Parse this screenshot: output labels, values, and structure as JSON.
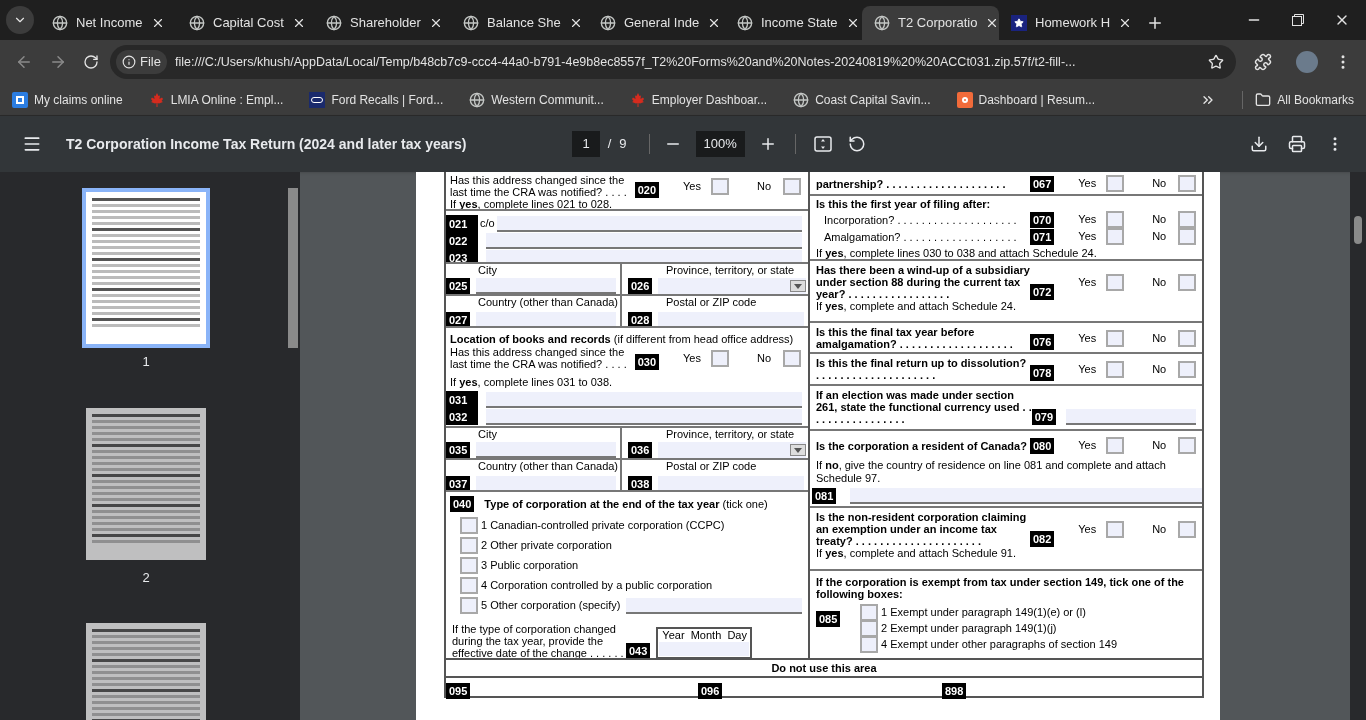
{
  "tabs": [
    {
      "title": "Net Income",
      "selected": false
    },
    {
      "title": "Capital Cost",
      "selected": false
    },
    {
      "title": "Shareholder",
      "selected": false
    },
    {
      "title": "Balance She",
      "selected": false
    },
    {
      "title": "General Inde",
      "selected": false
    },
    {
      "title": "Income State",
      "selected": false
    },
    {
      "title": "T2 Corporatio",
      "selected": true
    },
    {
      "title": "Homework H",
      "selected": false
    }
  ],
  "address": {
    "chip": "File",
    "url": "file:///C:/Users/khush/AppData/Local/Temp/b48cb7c9-ccc4-44a0-b791-4e9b8ec8557f_T2%20Forms%20and%20Notes-20240819%20%20ACCt031.zip.57f/t2-fill-..."
  },
  "bookmarks": [
    {
      "label": "My claims online"
    },
    {
      "label": "LMIA Online : Empl..."
    },
    {
      "label": "Ford Recalls | Ford..."
    },
    {
      "label": "Western Communit..."
    },
    {
      "label": "Employer Dashboar..."
    },
    {
      "label": "Coast Capital Savin..."
    },
    {
      "label": "Dashboard | Resum..."
    }
  ],
  "all_bookmarks": "All Bookmarks",
  "pdf": {
    "title": "T2 Corporation Income Tax Return (2024 and later tax years)",
    "page": "1",
    "separator": "/",
    "total": "9",
    "zoom": "100%"
  },
  "thumbnails": [
    {
      "label": "1",
      "selected": true
    },
    {
      "label": "2",
      "selected": false
    },
    {
      "selected": false
    }
  ],
  "left": [
    {
      "kind": "yesno",
      "question": "Has this address changed since the last time the CRA was notified? . . . .",
      "code": "020",
      "yes": "Yes",
      "no": "No",
      "yes_checked": false,
      "no_checked": false,
      "note": "If **yes**, complete lines 021 to 028."
    },
    {
      "kind": "lines",
      "lines": [
        {
          "code": "021",
          "prefix": "c/o"
        },
        {
          "code": "022"
        },
        {
          "code": "023"
        }
      ]
    },
    {
      "kind": "grid",
      "cells": [
        {
          "label": "City",
          "code": "025",
          "dropdown": false
        },
        {
          "label": "Province, territory, or state",
          "code": "026",
          "dropdown": true
        },
        {
          "label": "Country (other than Canada)",
          "code": "027",
          "dropdown": false
        },
        {
          "label": "Postal or ZIP code",
          "code": "028",
          "dropdown": false
        }
      ]
    },
    {
      "kind": "books",
      "heading": "**Location of books and records** (if different from head office address)",
      "question": "Has this address changed since the last time the CRA was notified? . . . .",
      "code": "030",
      "yes": "Yes",
      "no": "No",
      "yes_checked": false,
      "no_checked": false,
      "note": "If **yes**, complete lines 031 to 038.",
      "lines": [
        {
          "code": "031"
        },
        {
          "code": "032"
        }
      ]
    },
    {
      "kind": "grid",
      "cells": [
        {
          "label": "City",
          "code": "035",
          "dropdown": false
        },
        {
          "label": "Province, territory, or state",
          "code": "036",
          "dropdown": true
        },
        {
          "label": "Country (other than Canada)",
          "code": "037",
          "dropdown": false
        },
        {
          "label": "Postal or ZIP code",
          "code": "038",
          "dropdown": false
        }
      ]
    },
    {
      "kind": "choices",
      "code": "040",
      "title": "**Type of corporation at the end of the tax year** (tick one)",
      "options": [
        {
          "label": "1 Canadian-controlled private corporation (CCPC)",
          "checked": false,
          "field": false
        },
        {
          "label": "2 Other private corporation",
          "checked": false,
          "field": false
        },
        {
          "label": "3 Public corporation",
          "checked": false,
          "field": false
        },
        {
          "label": "4 Corporation controlled by a public corporation",
          "checked": false,
          "field": false
        },
        {
          "label": "5 Other corporation (specify)",
          "checked": false,
          "field": true
        }
      ],
      "change_text": "If the type of corporation changed during the tax year, provide the effective date of the change . . . . . .",
      "change_code": "043",
      "date_label": "Year  Month  Day"
    }
  ],
  "right": [
    {
      "kind": "yesno",
      "question": "partnership? . . . . . . . . . . . . . . . . . . . .",
      "code": "067",
      "yes": "Yes",
      "no": "No",
      "yes_checked": false,
      "no_checked": false
    },
    {
      "kind": "multi",
      "title": "Is this the first year of filing after:",
      "rows": [
        {
          "question": "Incorporation? . . . . . . . . . . . . . . . . . . . .",
          "code": "070",
          "yes": "Yes",
          "no": "No",
          "yes_checked": false,
          "no_checked": false
        },
        {
          "question": "Amalgamation? . . . . . . . . . . . . . . . . . . .",
          "code": "071",
          "yes": "Yes",
          "no": "No",
          "yes_checked": false,
          "no_checked": false
        }
      ],
      "note": "If **yes**, complete lines 030 to 038 and attach Schedule 24."
    },
    {
      "kind": "yesno",
      "question": "Has there been a wind-up of a subsidiary under section 88 during the current tax year? . . . . . . . . . . . . . . . . .",
      "code": "072",
      "yes": "Yes",
      "no": "No",
      "yes_checked": false,
      "no_checked": false,
      "note": "If **yes**, complete and attach Schedule 24."
    },
    {
      "kind": "yesno",
      "question": "Is this the final tax year before amalgamation? . . . . . . . . . . . . . . . . . . .",
      "code": "076",
      "yes": "Yes",
      "no": "No",
      "yes_checked": false,
      "no_checked": false
    },
    {
      "kind": "yesno",
      "question": "Is this the final return up to dissolution? . . . . . . . . . . . . . . . . . . . .",
      "code": "078",
      "yes": "Yes",
      "no": "No",
      "yes_checked": false,
      "no_checked": false
    },
    {
      "kind": "field",
      "question": "If an election was made under section 261, state the functional currency used . . . . . . . . . . . . . . . . .",
      "code": "079"
    },
    {
      "kind": "resident",
      "question": "Is the corporation a resident of Canada?",
      "code": "080",
      "yes": "Yes",
      "no": "No",
      "yes_checked": false,
      "no_checked": false,
      "note": "If **no**, give the country of residence on line 081 and complete and attach Schedule 97.",
      "line_code": "081"
    },
    {
      "kind": "yesno",
      "question": "Is the non-resident corporation claiming an exemption under an income tax treaty? . . . . . . . . . . . . . . . . . . . . .",
      "code": "082",
      "yes": "Yes",
      "no": "No",
      "yes_checked": false,
      "no_checked": false,
      "note": "If **yes**, complete and attach Schedule 91."
    },
    {
      "kind": "exempt",
      "title": "If the corporation is exempt from tax under section 149, tick one of the following boxes:",
      "code": "085",
      "options": [
        {
          "label": "1  Exempt under paragraph 149(1)(e) or (l)",
          "checked": false
        },
        {
          "label": "2  Exempt under paragraph 149(1)(j)",
          "checked": false
        },
        {
          "label": "4  Exempt under other paragraphs of section 149",
          "checked": false
        }
      ]
    }
  ],
  "footer": {
    "text": "Do not use this area",
    "codes": [
      "095",
      "096",
      "898"
    ]
  }
}
